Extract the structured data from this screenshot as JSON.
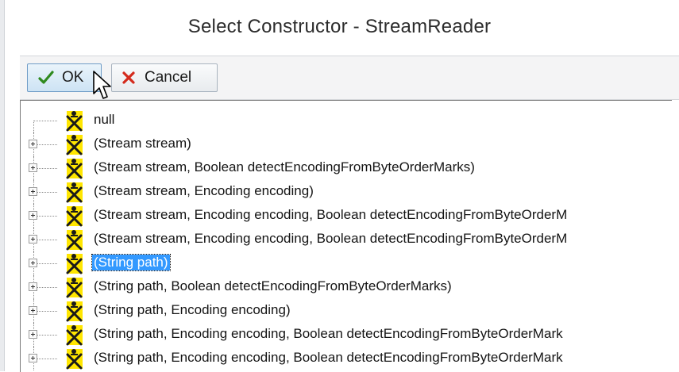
{
  "window": {
    "title": "Select Constructor - StreamReader"
  },
  "toolbar": {
    "ok_label": "OK",
    "cancel_label": "Cancel"
  },
  "tree": {
    "selected_index": 6,
    "items": [
      {
        "label": "null",
        "expandable": false
      },
      {
        "label": "(Stream stream)",
        "expandable": true
      },
      {
        "label": "(Stream stream, Boolean detectEncodingFromByteOrderMarks)",
        "expandable": true
      },
      {
        "label": "(Stream stream, Encoding encoding)",
        "expandable": true
      },
      {
        "label": "(Stream stream, Encoding encoding, Boolean detectEncodingFromByteOrderM",
        "expandable": true
      },
      {
        "label": "(Stream stream, Encoding encoding, Boolean detectEncodingFromByteOrderM",
        "expandable": true
      },
      {
        "label": "(String path)",
        "expandable": true
      },
      {
        "label": "(String path, Boolean detectEncodingFromByteOrderMarks)",
        "expandable": true
      },
      {
        "label": "(String path, Encoding encoding)",
        "expandable": true
      },
      {
        "label": "(String path, Encoding encoding, Boolean detectEncodingFromByteOrderMark",
        "expandable": true
      },
      {
        "label": "(String path, Encoding encoding, Boolean detectEncodingFromByteOrderMark",
        "expandable": true
      }
    ]
  },
  "icons": {
    "ok": "checkmark-icon",
    "cancel": "red-x-icon",
    "constructor": "constructor-icon",
    "cursor": "mouse-cursor"
  },
  "colors": {
    "selection": "#3399ff",
    "ok_button_hover": "#cde3f4",
    "constructor_icon_bg": "#ffe600",
    "cancel_x": "#d42a1c",
    "ok_check": "#2f8a1e"
  }
}
